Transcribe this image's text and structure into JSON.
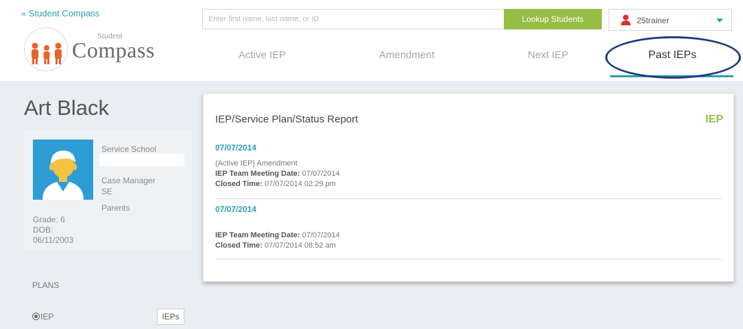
{
  "header": {
    "back_link": "« Student Compass",
    "logo_small": "Student",
    "logo_large": "Compass",
    "search_placeholder": "Enter first name, last name, or ID",
    "lookup_label": "Lookup Students",
    "user_name": "25trainer"
  },
  "tabs": {
    "active_iep": "Active IEP",
    "amendment": "Amendment",
    "next_iep": "Next IEP",
    "past_ieps": "Past IEPs"
  },
  "student": {
    "name": "Art Black",
    "service_school_label": "Service School",
    "case_manager_label": "Case Manager",
    "case_manager_value": "SE",
    "parents_label": "Parents",
    "grade": "Grade: 6",
    "dob_label": "DOB:",
    "dob_value": "06/11/2003"
  },
  "plans": {
    "label": "PLANS",
    "iep_label": "IEP",
    "ieps_button": "IEPs"
  },
  "report": {
    "title": "IEP/Service Plan/Status Report",
    "badge": "IEP",
    "entries": [
      {
        "date": "07/07/2014",
        "note": "(Active IEP) Amendment",
        "meeting_label": "IEP Team Meeting Date:",
        "meeting_value": "07/07/2014",
        "closed_label": "Closed Time:",
        "closed_value": "07/07/2014 02:29 pm"
      },
      {
        "date": "07/07/2014",
        "meeting_label": "IEP Team Meeting Date:",
        "meeting_value": "07/07/2014",
        "closed_label": "Closed Time:",
        "closed_value": "07/07/2014 08:52 am"
      }
    ]
  },
  "colors": {
    "accent": "#2e9fb3",
    "lookup_green": "#97bd46",
    "avatar_blue": "#2f9dd5",
    "highlight_ellipse": "#1f3d7a"
  }
}
